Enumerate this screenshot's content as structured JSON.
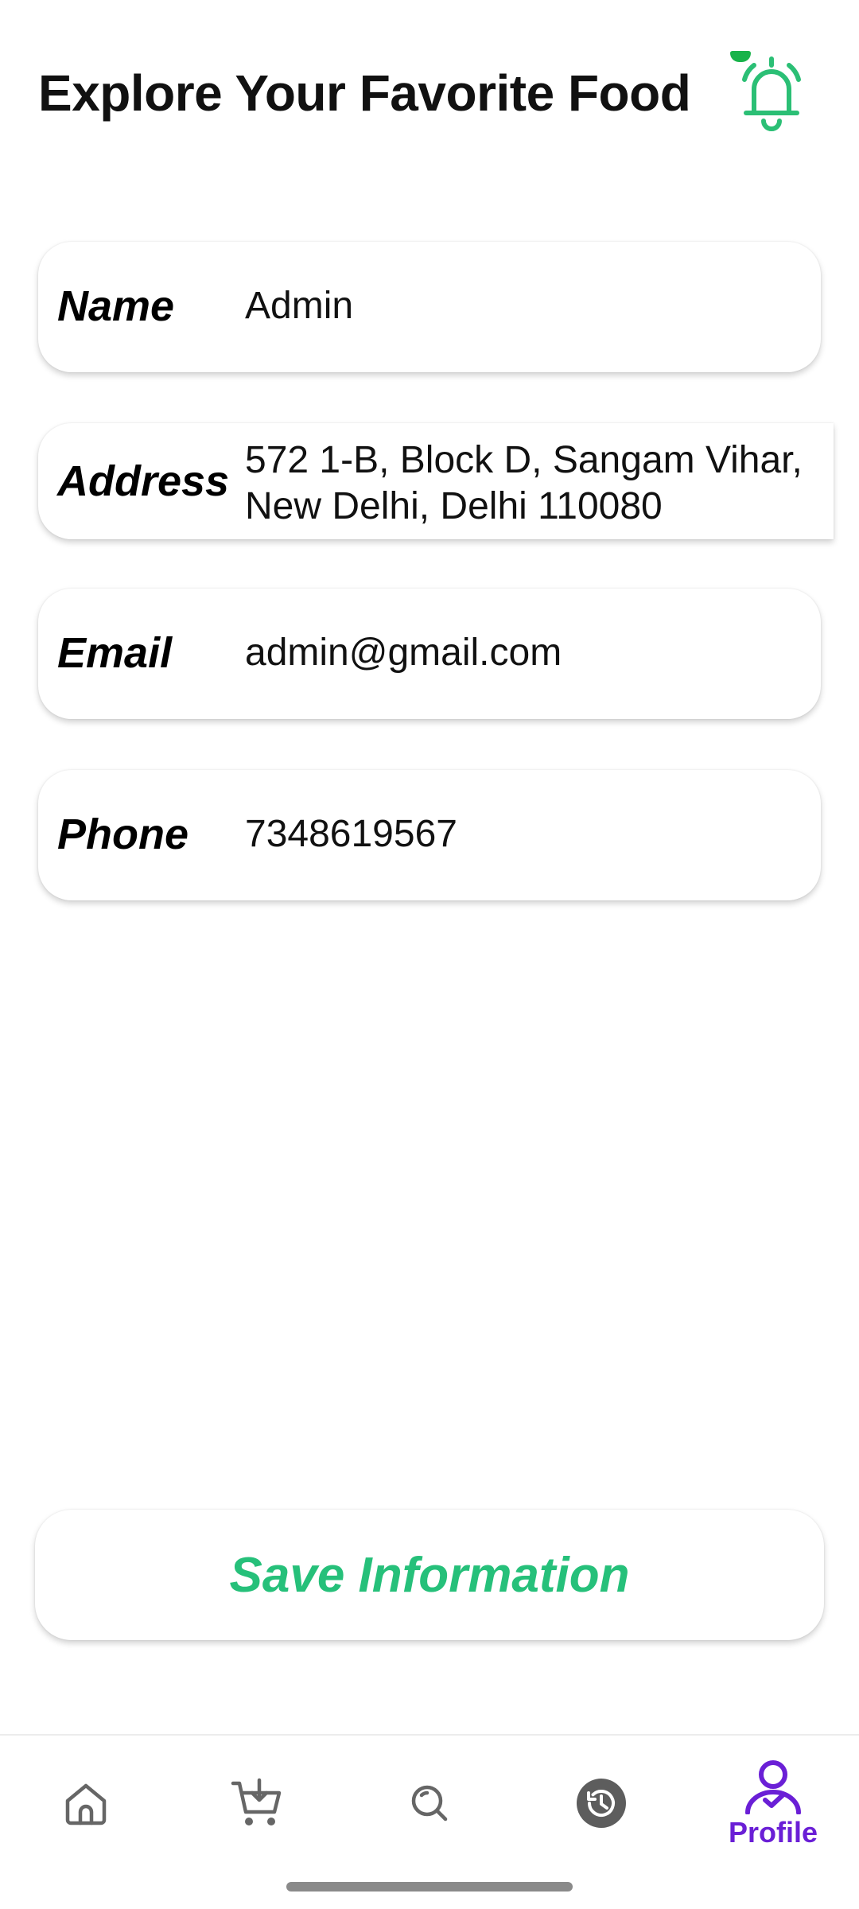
{
  "header": {
    "title": "Explore Your Favorite Food",
    "bell_icon": "notification-bell-icon",
    "accent_color": "#2bbf75"
  },
  "profile_form": {
    "fields": [
      {
        "label": "Name",
        "value": "Admin"
      },
      {
        "label": "Address",
        "value_line1": "572 1-B, Block D, Sangam Vihar,",
        "value_line2": "New Delhi, Delhi 110080"
      },
      {
        "label": "Email",
        "value": "admin@gmail.com"
      },
      {
        "label": "Phone",
        "value": "7348619567"
      }
    ]
  },
  "save_button": {
    "label": "Save Information",
    "color": "#26c07a"
  },
  "bottom_nav": {
    "items": [
      {
        "icon": "home-icon",
        "label": ""
      },
      {
        "icon": "cart-add-icon",
        "label": ""
      },
      {
        "icon": "search-icon",
        "label": ""
      },
      {
        "icon": "history-icon",
        "label": ""
      },
      {
        "icon": "profile-icon",
        "label": "Profile",
        "active": true
      }
    ],
    "active_color": "#6a1fd6",
    "inactive_color": "#666666"
  }
}
